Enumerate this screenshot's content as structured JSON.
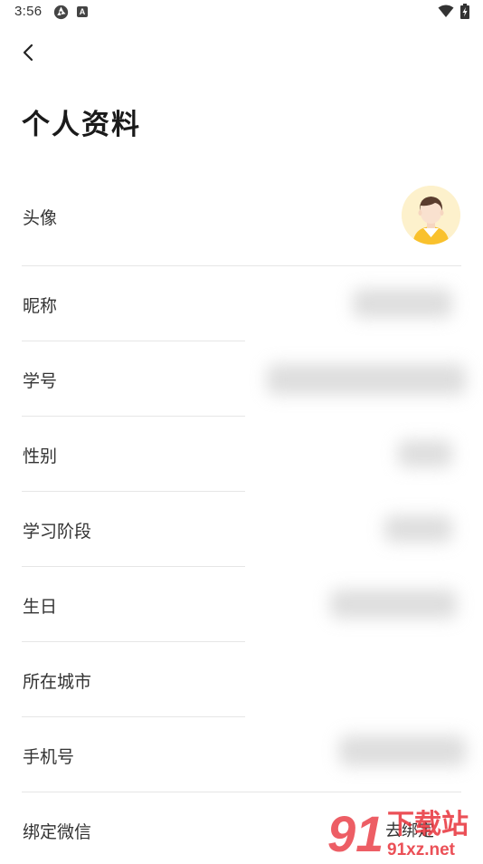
{
  "status_bar": {
    "time": "3:56",
    "app_icon_2_letter": "A"
  },
  "header": {
    "title": "个人资料"
  },
  "rows": {
    "avatar": {
      "label": "头像"
    },
    "nickname": {
      "label": "昵称"
    },
    "student_id": {
      "label": "学号"
    },
    "gender": {
      "label": "性别"
    },
    "study_stage": {
      "label": "学习阶段"
    },
    "birthday": {
      "label": "生日"
    },
    "city": {
      "label": "所在城市"
    },
    "phone": {
      "label": "手机号"
    },
    "wechat": {
      "label": "绑定微信",
      "action": "去绑定"
    }
  },
  "watermark": {
    "logo_number": "91",
    "site_name": "下载站",
    "domain": "91xz.net"
  },
  "colors": {
    "text_primary": "#222222",
    "divider": "#e6e6e6",
    "avatar_bg": "#fdf1cc",
    "watermark_red": "#e8313a"
  }
}
